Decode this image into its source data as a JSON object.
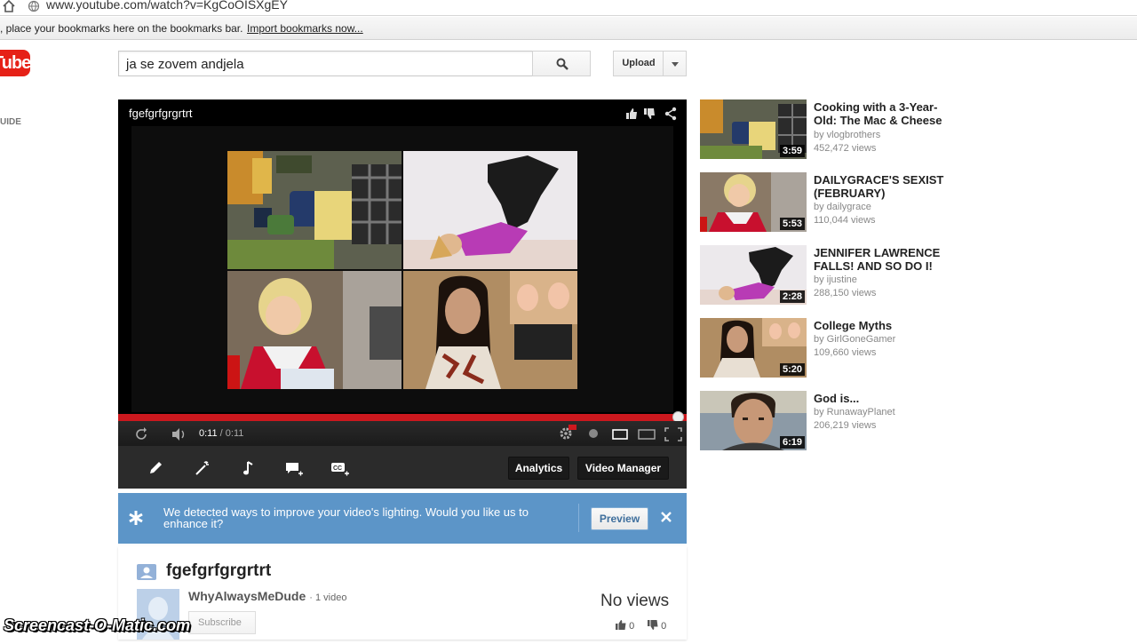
{
  "browser": {
    "url": "www.youtube.com/watch?v=KgCoOISXgEY",
    "bookmarks_text": ", place your bookmarks here on the bookmarks bar.",
    "import_link": "Import bookmarks now..."
  },
  "header": {
    "logo_text": "Tube",
    "search_value": "ja se zovem andjela",
    "upload_label": "Upload",
    "guide_label": "UIDE"
  },
  "player": {
    "title": "fgefgrfgrgrtrt",
    "time_current": "0:11",
    "time_duration": "/ 0:11",
    "progress_fraction": 1.0
  },
  "editor": {
    "analytics_label": "Analytics",
    "video_manager_label": "Video Manager"
  },
  "notice": {
    "text": "We detected ways to improve your video's lighting. Would you like us to enhance it?",
    "preview_label": "Preview"
  },
  "video": {
    "title": "fgefgrfgrgrtrt",
    "channel": "WhyAlwaysMeDude",
    "channel_count": "· 1 video",
    "subscribe_label": "Subscribe",
    "views": "No views",
    "likes": "0",
    "dislikes": "0"
  },
  "related": [
    {
      "title": "Cooking with a 3-Year-Old: The Mac & Cheese",
      "by": "by vlogbrothers",
      "views": "452,472 views",
      "duration": "3:59"
    },
    {
      "title": "DAILYGRACE'S SEXIST (FEBRUARY)",
      "by": "by dailygrace",
      "views": "110,044 views",
      "duration": "5:53"
    },
    {
      "title": "JENNIFER LAWRENCE FALLS! AND SO DO I!",
      "by": "by ijustine",
      "views": "288,150 views",
      "duration": "2:28"
    },
    {
      "title": "College Myths",
      "by": "by GirlGoneGamer",
      "views": "109,660 views",
      "duration": "5:20"
    },
    {
      "title": "God is...",
      "by": "by RunawayPlanet",
      "views": "206,219 views",
      "duration": "6:19"
    }
  ],
  "watermark": "Screencast-O-Matic.com",
  "colors": {
    "brand_red": "#e62117",
    "progress_red": "#cc181e",
    "notice_blue": "#5c95c8"
  }
}
